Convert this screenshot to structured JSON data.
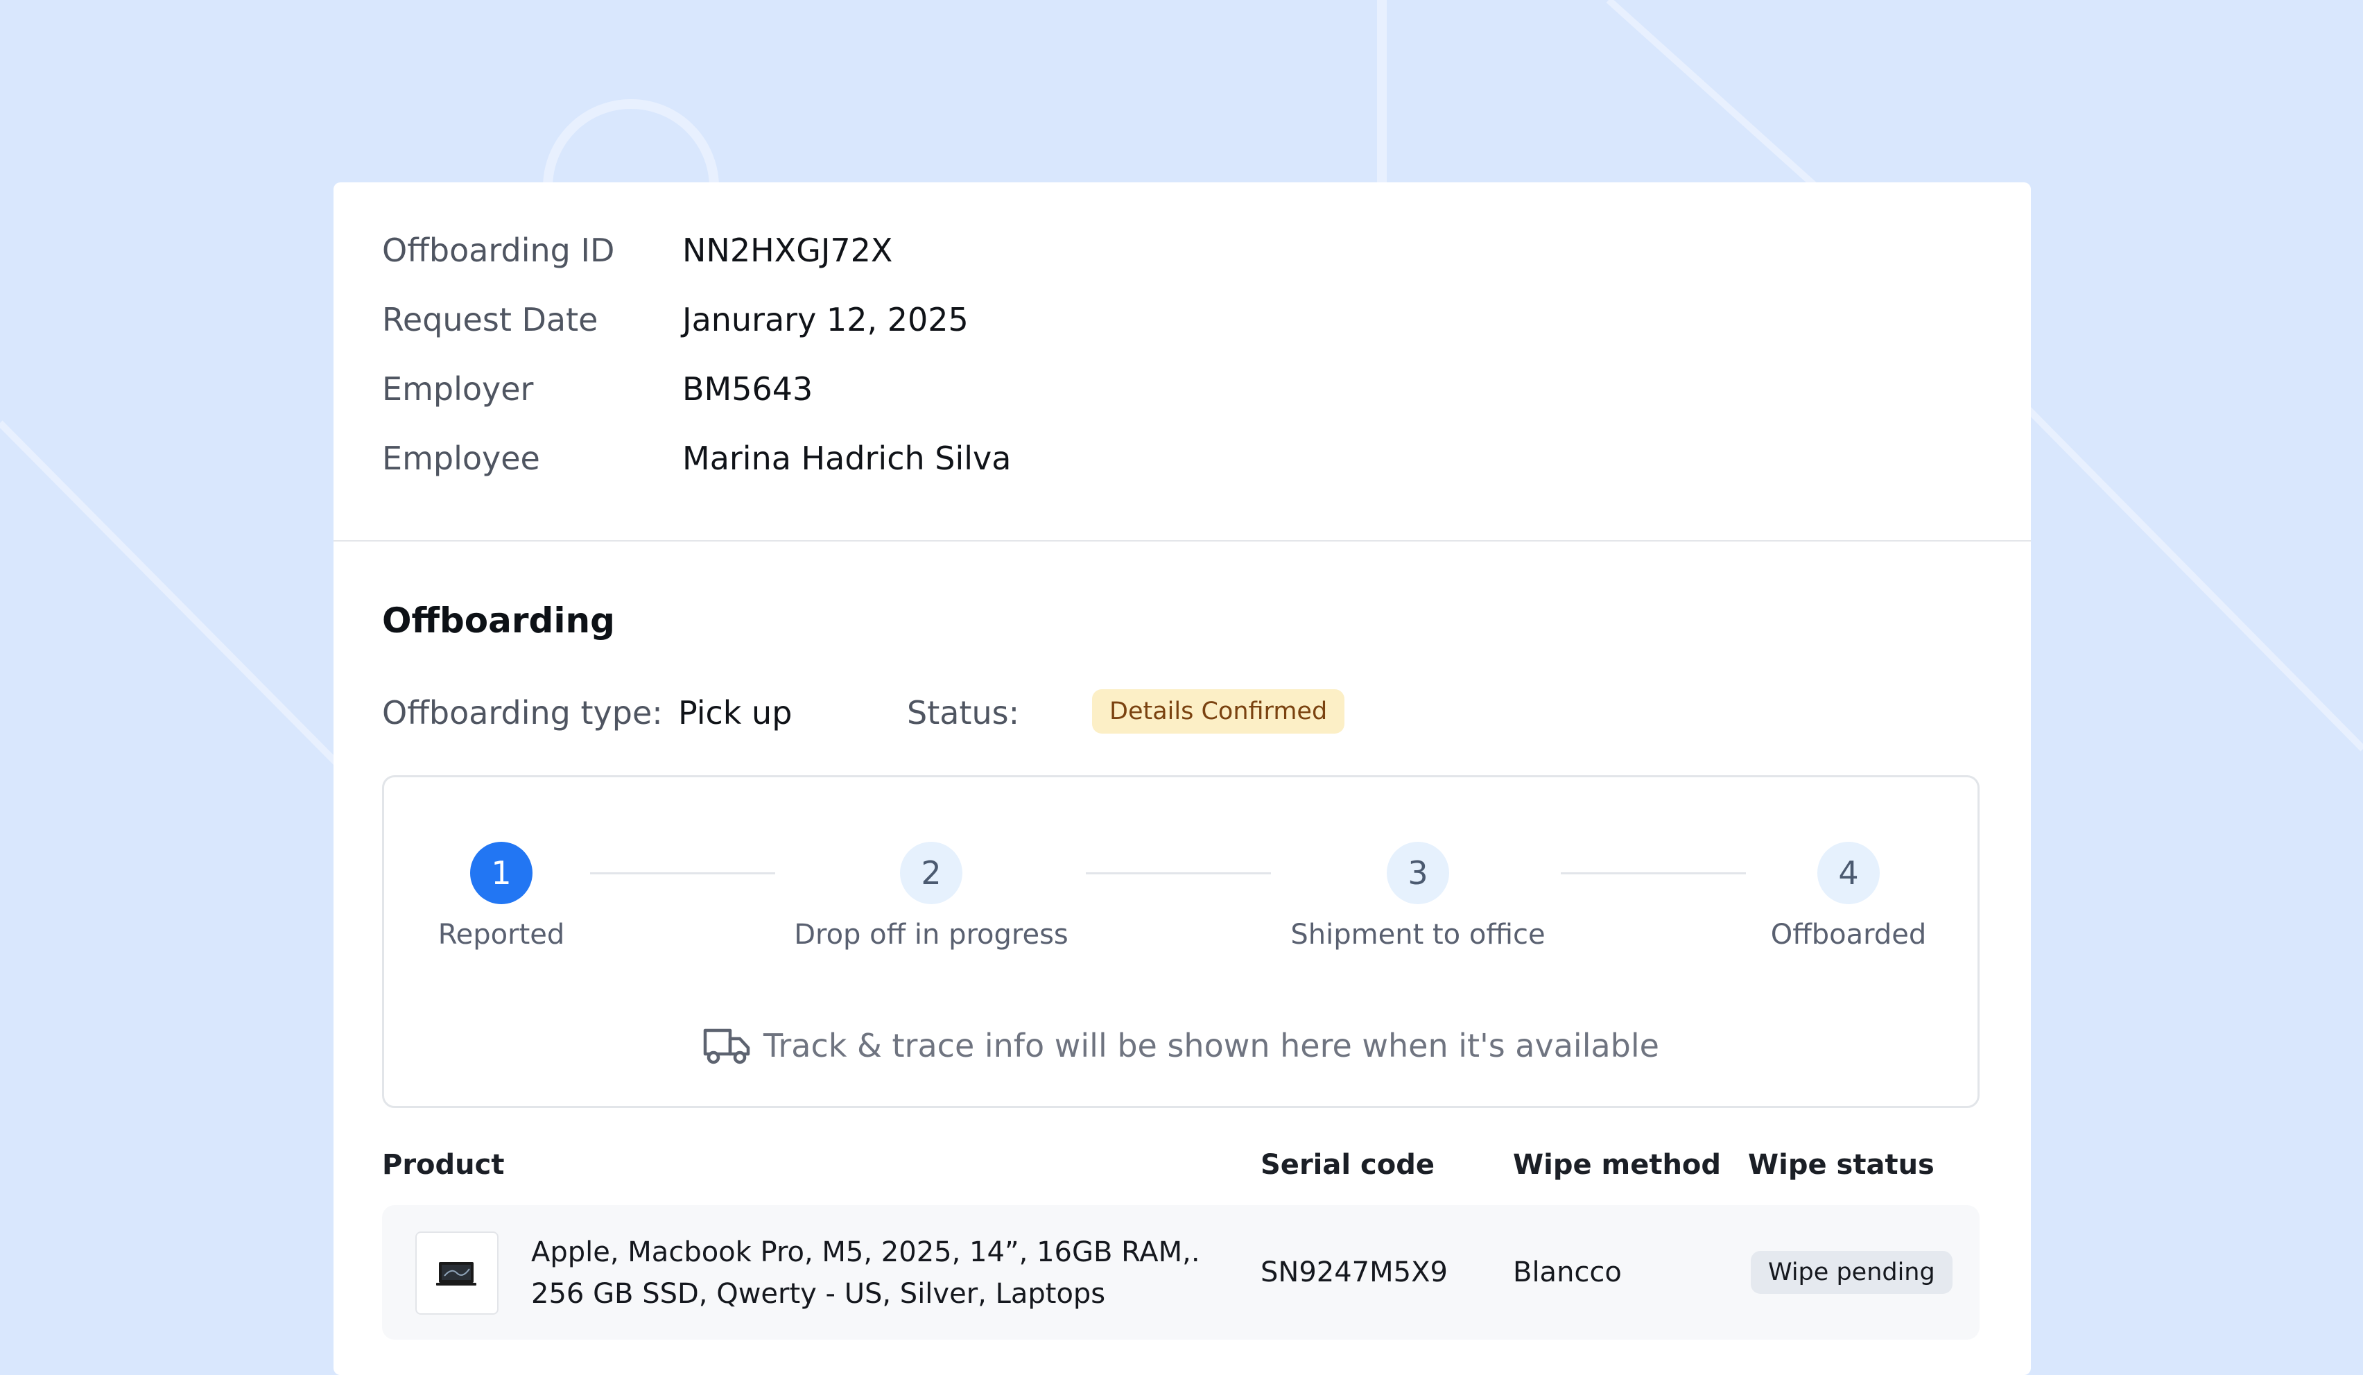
{
  "details": {
    "rows": [
      {
        "label": "Offboarding ID",
        "value": "NN2HXGJ72X"
      },
      {
        "label": "Request Date",
        "value": "Janurary 12, 2025"
      },
      {
        "label": "Employer",
        "value": "BM5643"
      },
      {
        "label": "Employee",
        "value": "Marina Hadrich Silva"
      }
    ]
  },
  "offboarding": {
    "title": "Offboarding",
    "type_label": "Offboarding type:",
    "type_value": "Pick up",
    "status_label": "Status:",
    "status_value": "Details Confirmed",
    "status_color": "#fcefc6"
  },
  "tracker": {
    "active_color": "#2276f3",
    "steps": [
      {
        "number": "1",
        "label": "Reported",
        "active": true
      },
      {
        "number": "2",
        "label": "Drop off in progress",
        "active": false
      },
      {
        "number": "3",
        "label": "Shipment to office",
        "active": false
      },
      {
        "number": "4",
        "label": "Offboarded",
        "active": false
      }
    ],
    "info_icon": "truck-icon",
    "info_text": "Track & trace info will be shown here when it's available"
  },
  "table": {
    "headers": {
      "product": "Product",
      "serial": "Serial code",
      "wipe_method": "Wipe method",
      "wipe_status": "Wipe status"
    },
    "rows": [
      {
        "thumbnail_icon": "laptop-icon",
        "product": "Apple, Macbook Pro, M5, 2025, 14”, 16GB RAM,. 256 GB SSD, Qwerty - US, Silver, Laptops",
        "serial": "SN9247M5X9",
        "wipe_method": "Blancco",
        "wipe_status": "Wipe pending"
      }
    ]
  }
}
